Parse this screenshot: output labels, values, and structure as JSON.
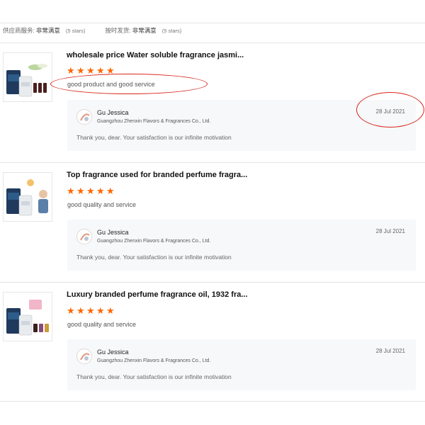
{
  "summary": {
    "supplier_service_label": "供应商服务:",
    "supplier_service_value": "非常满意",
    "supplier_service_stars": "(5 stars)",
    "on_time_label": "按时发货:",
    "on_time_value": "非常满意",
    "on_time_stars": "(5 stars)"
  },
  "colors": {
    "star": "#ff6600",
    "annotation": "#d9261c",
    "reply_bg": "#f6f8fa"
  },
  "reviews": [
    {
      "product_title": "wholesale price Water soluble fragrance jasmi...",
      "rating": 5,
      "review_text": "good product and good service",
      "reply": {
        "name": "Gu Jessica",
        "company": "Guangzhou Zhenxin Flavors & Fragrances Co., Ltd.",
        "message": "Thank you, dear. Your satisfaction is our infinite motivation",
        "date": "28 Jul 2021"
      }
    },
    {
      "product_title": "Top fragrance used for branded perfume fragra...",
      "rating": 5,
      "review_text": "good quality and service",
      "reply": {
        "name": "Gu Jessica",
        "company": "Guangzhou Zhenxin Flavors & Fragrances Co., Ltd.",
        "message": "Thank you, dear. Your satisfaction is our infinite motivation",
        "date": "28 Jul 2021"
      }
    },
    {
      "product_title": "Luxury branded perfume fragrance oil, 1932 fra...",
      "rating": 5,
      "review_text": "good quality and service",
      "reply": {
        "name": "Gu Jessica",
        "company": "Guangzhou Zhenxin Flavors & Fragrances Co., Ltd.",
        "message": "Thank you, dear. Your satisfaction is our infinite motivation",
        "date": "28 Jul 2021"
      }
    }
  ]
}
